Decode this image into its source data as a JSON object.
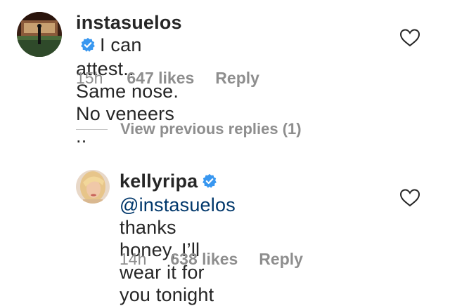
{
  "comments": [
    {
      "username": "instasuelos",
      "verified": true,
      "line1": "I can attest..",
      "line2": "Same nose. No veneers ..",
      "time": "15h",
      "likes": "647 likes",
      "reply_label": "Reply",
      "avatar_icon": "stage-avatar"
    },
    {
      "username": "kellyripa",
      "verified": true,
      "mention": "@instasuelos",
      "line1": "thanks honey, I’ll wear it for",
      "line2": "you tonight",
      "time": "14h",
      "likes": "638 likes",
      "reply_label": "Reply",
      "avatar_icon": "profile-photo-avatar"
    }
  ],
  "view_replies": {
    "label": "View previous replies (1)"
  },
  "colors": {
    "text": "#262626",
    "secondary": "#8e8e8e",
    "verified_blue": "#3897f0",
    "mention": "#00376b"
  },
  "icons": {
    "verified": "verified-badge-icon",
    "like": "heart-outline-icon"
  }
}
